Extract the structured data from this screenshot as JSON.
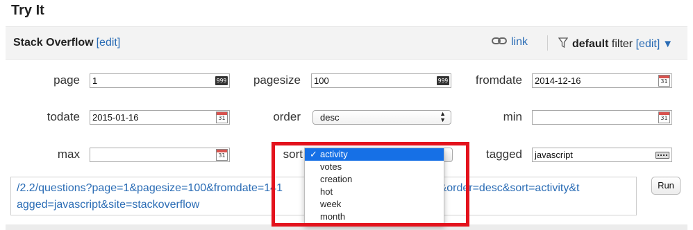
{
  "page": {
    "title": "Try It"
  },
  "site_bar": {
    "site_name": "Stack Overflow",
    "edit_label": "[edit]",
    "link_label": "link",
    "filter_name": "default",
    "filter_word": "filter",
    "filter_edit": "[edit]",
    "filter_caret": "▼"
  },
  "fields": {
    "page": {
      "label": "page",
      "value": "1",
      "icon": "999"
    },
    "pagesize": {
      "label": "pagesize",
      "value": "100",
      "icon": "999"
    },
    "fromdate": {
      "label": "fromdate",
      "value": "2014-12-16",
      "icon": "31"
    },
    "todate": {
      "label": "todate",
      "value": "2015-01-16",
      "icon": "31"
    },
    "order": {
      "label": "order",
      "value": "desc"
    },
    "min": {
      "label": "min",
      "value": "",
      "icon": "31"
    },
    "max": {
      "label": "max",
      "value": "",
      "icon": "31"
    },
    "sort": {
      "label": "sort"
    },
    "tagged": {
      "label": "tagged",
      "value": "javascript"
    }
  },
  "sort_dropdown": {
    "check": "✓",
    "options": [
      "activity",
      "votes",
      "creation",
      "hot",
      "week",
      "month"
    ],
    "selected": "activity"
  },
  "url_box": {
    "text": "/2.2/questions?page=1&pagesize=100&fromdate=141",
    "text_2": "6400&order=desc&sort=activity&t",
    "line2": "agged=javascript&site=stackoverflow"
  },
  "run_button": {
    "label": "Run"
  },
  "colors": {
    "link": "#2a6cb5",
    "highlight": "#e3121c",
    "selected": "#1670e6"
  }
}
